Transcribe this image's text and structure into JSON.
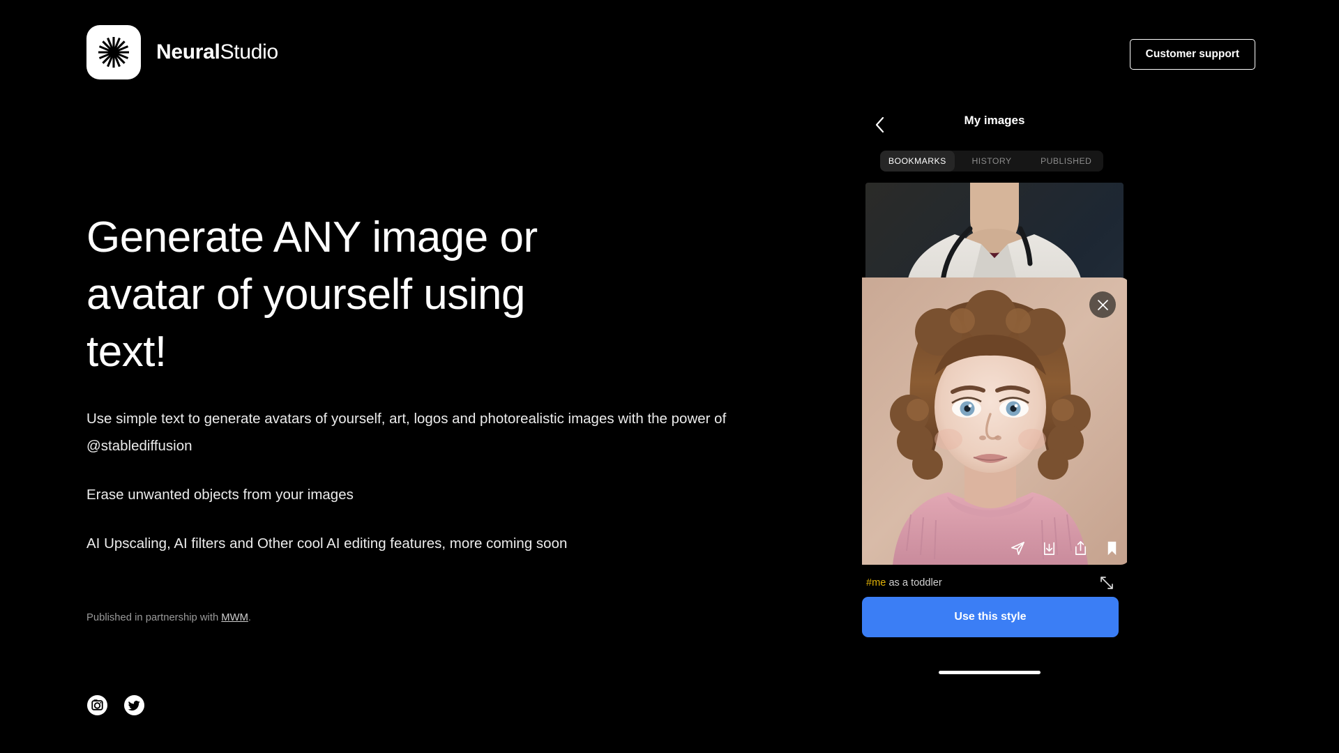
{
  "header": {
    "brand_bold": "Neural",
    "brand_light": "Studio",
    "logo_icon": "asterisk-burst-icon",
    "support_label": "Customer support"
  },
  "hero": {
    "heading": "Generate ANY image or avatar of yourself using text!",
    "paragraph1": "Use simple text to generate avatars of yourself, art, logos and photorealistic images with the power of @stablediffusion",
    "paragraph2": "Erase unwanted objects from your images",
    "paragraph3": "AI Upscaling, AI filters and Other cool AI editing features, more coming soon",
    "partner_prefix": "Published in partnership with ",
    "partner_link": "MWM",
    "partner_suffix": ".",
    "socials": [
      {
        "name": "instagram-icon",
        "label": "Instagram"
      },
      {
        "name": "twitter-icon",
        "label": "Twitter"
      }
    ]
  },
  "panel": {
    "back_icon": "chevron-left-icon",
    "title": "My images",
    "tabs": [
      {
        "label": "BOOKMARKS",
        "active": true
      },
      {
        "label": "HISTORY",
        "active": false
      },
      {
        "label": "PUBLISHED",
        "active": false
      }
    ],
    "background_thumb": {
      "name": "doctor-lab-coat-thumbnail",
      "description": "Person in white lab coat with stethoscope and maroon shirt on dark blue background"
    },
    "modal": {
      "close_icon": "close-icon",
      "image": {
        "name": "toddler-portrait",
        "description": "Toddler with brown curly hair, blue eyes, pink knit sweater on warm beige background"
      },
      "actions": [
        {
          "name": "send-icon",
          "label": "Send"
        },
        {
          "name": "download-icon",
          "label": "Download"
        },
        {
          "name": "share-icon",
          "label": "Share"
        },
        {
          "name": "bookmark-icon",
          "label": "Bookmark"
        }
      ],
      "caption_tag": "#me",
      "caption_text": " as a toddler",
      "expand_icon": "expand-diagonal-icon",
      "primary_button": "Use this style"
    }
  },
  "colors": {
    "background": "#000000",
    "accent_blue": "#3b7ef5",
    "tag_yellow": "#e0b106",
    "tab_bar": "#161616",
    "tab_active": "#262626"
  }
}
